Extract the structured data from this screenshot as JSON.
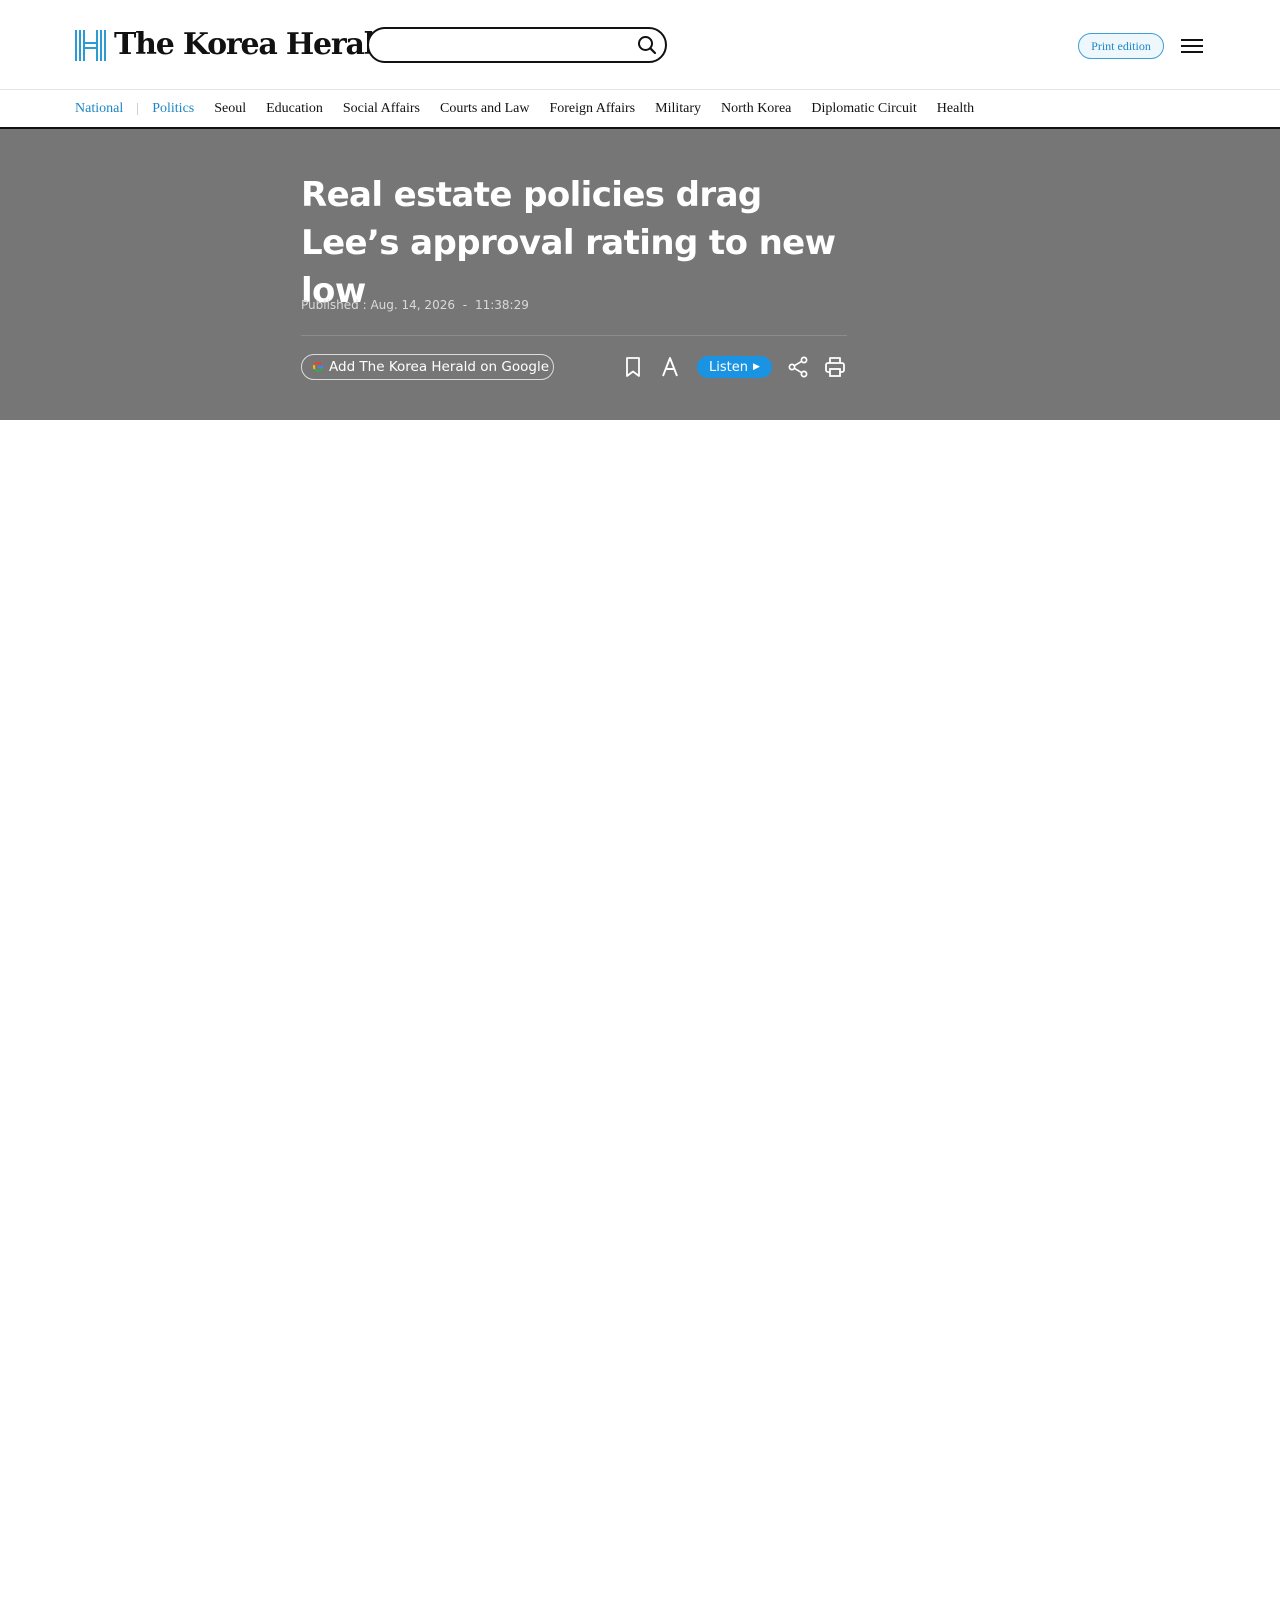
{
  "site": {
    "name": "The Korea Herald",
    "logo_icon": "herald-h-mark",
    "accent_color": "#1e86c6"
  },
  "header": {
    "search": {
      "value": "",
      "placeholder": ""
    },
    "search_icon": "magnifier-icon",
    "print_edition_label": "Print edition",
    "menu_icon": "hamburger-icon"
  },
  "nav": {
    "section": "National",
    "items": [
      {
        "label": "Politics",
        "active": true
      },
      {
        "label": "Seoul"
      },
      {
        "label": "Education"
      },
      {
        "label": "Social Affairs"
      },
      {
        "label": "Courts and Law"
      },
      {
        "label": "Foreign Affairs"
      },
      {
        "label": "Military"
      },
      {
        "label": "North Korea"
      },
      {
        "label": "Diplomatic Circuit"
      },
      {
        "label": "Health"
      }
    ]
  },
  "article": {
    "headline": "Real estate policies drag Lee’s approval rating to new low",
    "published_label": "Published :",
    "published_date": "Aug. 14, 2026",
    "published_separator": "-",
    "published_time": "11:38:29",
    "hero_background": "#767676"
  },
  "toolbar": {
    "google_label": "Add The Korea Herald on Google",
    "google_icon": "google-g-icon",
    "bookmark_icon": "bookmark-icon",
    "font_icon": "font-size-icon",
    "listen_label": "Listen",
    "listen_icon": "play-arrow-icon",
    "listen_color": "#1a93e2",
    "share_icon": "share-icon",
    "print_icon": "printer-icon"
  }
}
